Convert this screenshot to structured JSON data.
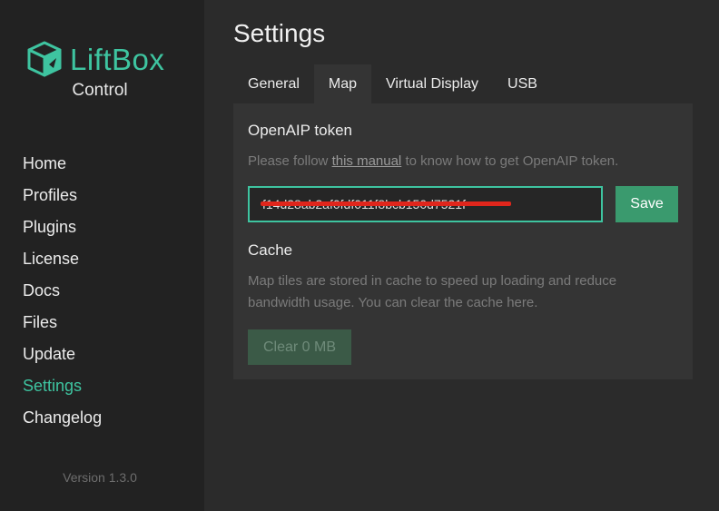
{
  "sidebar": {
    "brand": "LiftBox",
    "subtitle": "Control",
    "items": [
      {
        "label": "Home"
      },
      {
        "label": "Profiles"
      },
      {
        "label": "Plugins"
      },
      {
        "label": "License"
      },
      {
        "label": "Docs"
      },
      {
        "label": "Files"
      },
      {
        "label": "Update"
      },
      {
        "label": "Settings",
        "active": true
      },
      {
        "label": "Changelog"
      }
    ],
    "version": "Version 1.3.0"
  },
  "page": {
    "title": "Settings",
    "tabs": [
      {
        "label": "General"
      },
      {
        "label": "Map",
        "active": true
      },
      {
        "label": "Virtual Display"
      },
      {
        "label": "USB"
      }
    ]
  },
  "openaip": {
    "title": "OpenAIP token",
    "hint_before": "Please follow ",
    "hint_link": "this manual",
    "hint_after": " to know how to get OpenAIP token.",
    "token_value": "f14d28ab2af0fdf011f8bcb150d7521f",
    "save_label": "Save"
  },
  "cache": {
    "title": "Cache",
    "description": "Map tiles are stored in cache to speed up loading and reduce bandwidth usage. You can clear the cache here.",
    "clear_label": "Clear 0 MB"
  },
  "colors": {
    "accent": "#3ec4a0",
    "save_button": "#3a9a6e",
    "redaction": "#e0261c"
  },
  "icons": {
    "logo": "box-icon"
  }
}
